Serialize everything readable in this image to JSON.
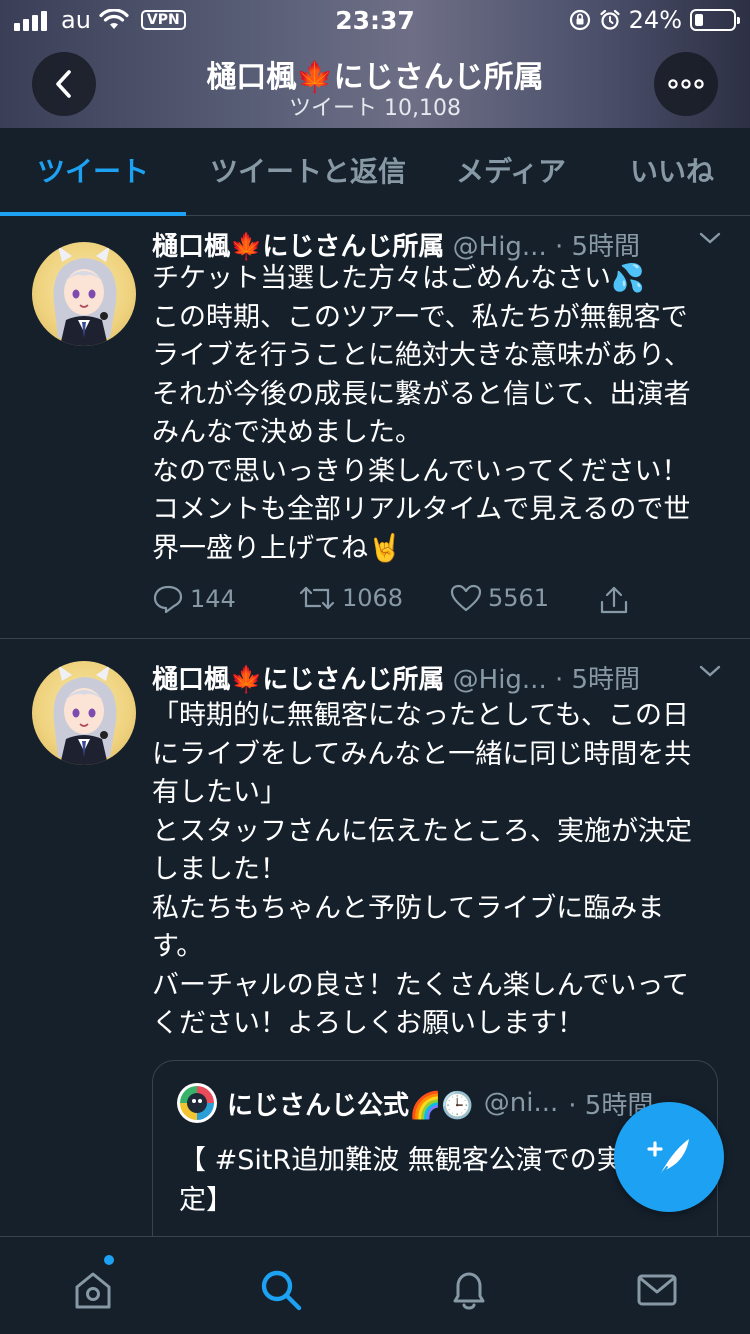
{
  "status_bar": {
    "carrier": "au",
    "vpn": "VPN",
    "time": "23:37",
    "battery": "24%"
  },
  "header": {
    "title": "樋口楓🍁にじさんじ所属",
    "subtitle": "ツイート 10,108"
  },
  "tabs": [
    {
      "label": "ツイート",
      "active": true
    },
    {
      "label": "ツイートと返信",
      "active": false
    },
    {
      "label": "メディア",
      "active": false
    },
    {
      "label": "いいね",
      "active": false
    }
  ],
  "tweets": [
    {
      "name": "樋口楓🍁にじさんじ所属",
      "handle": "@Hig...",
      "time": "· 5時間",
      "body": "チケット当選した方々はごめんなさい💦\nこの時期、このツアーで、私たちが無観客で\nライブを行うことに絶対大きな意味があり、\nそれが今後の成長に繋がると信じて、出演者\nみんなで決めました。\nなので思いっきり楽しんでいってください！\nコメントも全部リアルタイムで見えるので世\n界一盛り上げてね🤘",
      "replies": "144",
      "retweets": "1068",
      "likes": "5561"
    },
    {
      "name": "樋口楓🍁にじさんじ所属",
      "handle": "@Hig...",
      "time": "· 5時間",
      "body": "「時期的に無観客になったとしても、この日\nにライブをしてみんなと一緒に同じ時間を共\n有したい」\nとスタッフさんに伝えたところ、実施が決定\nしました！\n私たちもちゃんと予防してライブに臨みま\nす。\nバーチャルの良さ！たくさん楽しんでいって\nください！よろしくお願いします！",
      "quote": {
        "name": "にじさんじ公式🌈🕒",
        "handle": "@ni...",
        "time": "· 5時間",
        "body": "【 #SitR追加難波 無観客公演での実施決\n定】"
      }
    }
  ],
  "colors": {
    "background": "#15202b",
    "accent": "#1da1f2",
    "muted": "#8899a6",
    "divider": "#38444d"
  },
  "icons": {
    "back": "chevron-left-icon",
    "more": "more-horizontal-icon",
    "compose": "compose-tweet-icon",
    "nav": [
      "home-icon",
      "search-icon",
      "bell-icon",
      "mail-icon"
    ]
  }
}
